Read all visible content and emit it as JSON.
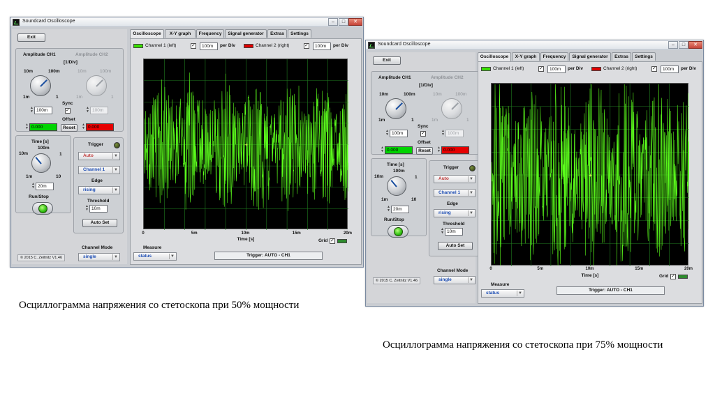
{
  "windows": [
    {
      "title": "Soundcard Oscilloscope",
      "exit_label": "Exit",
      "amplitude_ch1_label": "Amplitude CH1",
      "amplitude_ch2_label": "Amplitude CH2",
      "per_div_unit": "[1/Div]",
      "knob_scale": {
        "low": "1m",
        "mid": "10m",
        "high": "100m",
        "max": "1"
      },
      "ch1_amplitude_value": "100m",
      "ch2_amplitude_value": "100m",
      "sync_label": "Sync",
      "offset_label": "Offset",
      "ch1_offset_value": "0.000",
      "ch2_offset_value": "0.000",
      "reset_label": "Reset",
      "time_label": "Time [s]",
      "time_scale": {
        "low": "1m",
        "mid": "10m",
        "high": "100m",
        "max": "1",
        "min": "10"
      },
      "time_value": "20m",
      "run_stop_label": "Run/Stop",
      "trigger_label": "Trigger",
      "trigger_mode": "Auto",
      "trigger_channel": "Channel 1",
      "edge_label": "Edge",
      "edge_value": "rising",
      "threshold_label": "Threshold",
      "threshold_value": "10m",
      "auto_set_label": "Auto Set",
      "channel_mode_label": "Channel Mode",
      "channel_mode_value": "single",
      "copyright": "© 2015  C. Zeitnitz V1.46",
      "tabs": [
        "Oscilloscope",
        "X-Y graph",
        "Frequency",
        "Signal generator",
        "Extras",
        "Settings"
      ],
      "ch1_label": "Channel 1 (left)",
      "ch2_label": "Channel 2 (right)",
      "ch1_per_div": "100m",
      "ch2_per_div": "100m",
      "per_div_label": "per Div",
      "x_ticks": [
        "0",
        "5m",
        "10m",
        "15m",
        "20m"
      ],
      "x_axis_label": "Time [s]",
      "grid_label": "Grid",
      "measure_label": "Measure",
      "measure_value": "status",
      "trigger_status": "Trigger: AUTO - CH1",
      "chart_data": {
        "type": "line",
        "xlabel": "Time [s]",
        "xlim": [
          0,
          0.02
        ],
        "x_ticks": [
          "0",
          "5m",
          "10m",
          "15m",
          "20m"
        ],
        "grid": true,
        "series": [
          {
            "color": "#5cff1c",
            "shape": "dense noise burst",
            "amplitude_div": 3.2
          }
        ]
      }
    },
    {
      "title": "Soundcard Oscilloscope",
      "exit_label": "Exit",
      "amplitude_ch1_label": "Amplitude CH1",
      "amplitude_ch2_label": "Amplitude CH2",
      "per_div_unit": "[1/Div]",
      "knob_scale": {
        "low": "1m",
        "mid": "10m",
        "high": "100m",
        "max": "1"
      },
      "ch1_amplitude_value": "100m",
      "ch2_amplitude_value": "100m",
      "sync_label": "Sync",
      "offset_label": "Offset",
      "ch1_offset_value": "0.000",
      "ch2_offset_value": "0.000",
      "reset_label": "Reset",
      "time_label": "Time [s]",
      "time_scale": {
        "low": "1m",
        "mid": "10m",
        "high": "100m",
        "max": "1",
        "min": "10"
      },
      "time_value": "20m",
      "run_stop_label": "Run/Stop",
      "trigger_label": "Trigger",
      "trigger_mode": "Auto",
      "trigger_channel": "Channel 1",
      "edge_label": "Edge",
      "edge_value": "rising",
      "threshold_label": "Threshold",
      "threshold_value": "10m",
      "auto_set_label": "Auto Set",
      "channel_mode_label": "Channel Mode",
      "channel_mode_value": "single",
      "copyright": "© 2015  C. Zeitnitz V1.46",
      "tabs": [
        "Oscilloscope",
        "X-Y graph",
        "Frequency",
        "Signal generator",
        "Extras",
        "Settings"
      ],
      "ch1_label": "Channel 1 (left)",
      "ch2_label": "Channel 2 (right)",
      "ch1_per_div": "100m",
      "ch2_per_div": "100m",
      "per_div_label": "per Div",
      "x_ticks": [
        "0",
        "5m",
        "10m",
        "15m",
        "20m"
      ],
      "x_axis_label": "Time [s]",
      "grid_label": "Grid",
      "measure_label": "Measure",
      "measure_value": "status",
      "trigger_status": "Trigger: AUTO - CH1",
      "chart_data": {
        "type": "line",
        "xlabel": "Time [s]",
        "xlim": [
          0,
          0.02
        ],
        "x_ticks": [
          "0",
          "5m",
          "10m",
          "15m",
          "20m"
        ],
        "grid": true,
        "series": [
          {
            "color": "#5cff1c",
            "shape": "dense noise burst",
            "amplitude_div": 4.5
          }
        ]
      }
    }
  ],
  "captions": [
    "Осциллограмма напряжения со стетоскопа при 50% мощности",
    "Осциллограмма напряжения со стетоскопа при 75% мощности"
  ],
  "colors": {
    "trace": "#5cff1c",
    "grid": "#1f7a1f",
    "ch1": "#38e000",
    "ch2": "#e00000",
    "plot_bg": "#000000"
  }
}
